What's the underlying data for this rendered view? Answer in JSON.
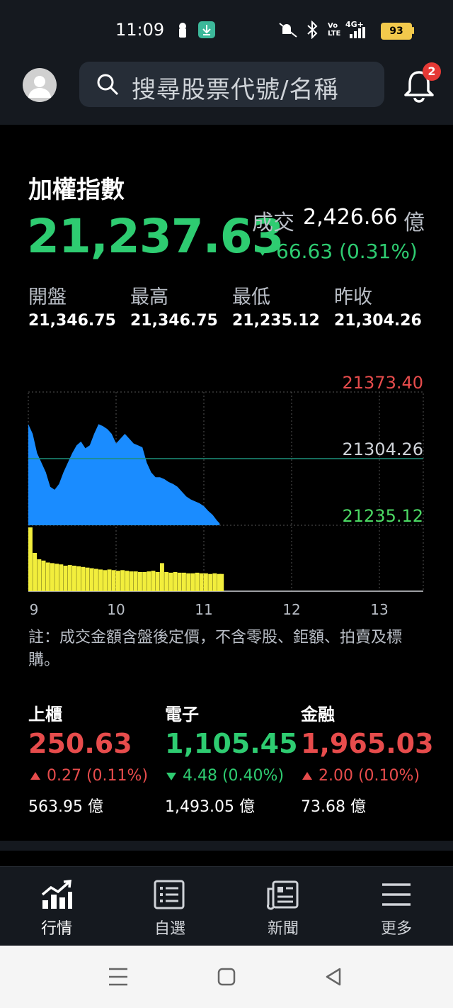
{
  "status_bar": {
    "time": "11:09",
    "battery": "93",
    "icons": [
      "lock-icon",
      "download-icon",
      "mute-icon",
      "bluetooth-icon",
      "volte-icon",
      "signal-4g-icon",
      "battery-icon"
    ],
    "signal_label": "4G+",
    "volte_label": "Vo LTE"
  },
  "header": {
    "search_placeholder": "搜尋股票代號/名稱",
    "notification_count": "2"
  },
  "index": {
    "name": "加權指數",
    "value": "21,237.63",
    "volume_label": "成交",
    "volume_value": "2,426.66",
    "volume_unit": "億",
    "change": "66.63 (0.31%)",
    "direction": "down",
    "stats": [
      {
        "label": "開盤",
        "value": "21,346.75"
      },
      {
        "label": "最高",
        "value": "21,346.75"
      },
      {
        "label": "最低",
        "value": "21,235.12"
      },
      {
        "label": "昨收",
        "value": "21,304.26"
      }
    ]
  },
  "chart_data": {
    "type": "area",
    "price_labels": {
      "high": "21373.40",
      "prev_close": "21304.26",
      "low": "21235.12"
    },
    "ylim": [
      21235.12,
      21373.4
    ],
    "x_ticks": [
      "9",
      "10",
      "11",
      "12",
      "13"
    ],
    "time_x": [
      9.0,
      9.05,
      9.1,
      9.15,
      9.2,
      9.25,
      9.3,
      9.35,
      9.4,
      9.45,
      9.5,
      9.55,
      9.6,
      9.65,
      9.7,
      9.75,
      9.8,
      9.85,
      9.9,
      9.95,
      10.0,
      10.05,
      10.1,
      10.15,
      10.2,
      10.25,
      10.3,
      10.35,
      10.4,
      10.45,
      10.5,
      10.55,
      10.6,
      10.65,
      10.7,
      10.75,
      10.8,
      10.85,
      10.9,
      10.95,
      11.0,
      11.05,
      11.1,
      11.15,
      11.18
    ],
    "price_values": [
      21340,
      21330,
      21310,
      21300,
      21290,
      21275,
      21272,
      21278,
      21290,
      21300,
      21310,
      21318,
      21322,
      21315,
      21318,
      21330,
      21340,
      21338,
      21335,
      21330,
      21320,
      21325,
      21330,
      21325,
      21320,
      21318,
      21316,
      21300,
      21290,
      21285,
      21285,
      21283,
      21280,
      21278,
      21275,
      21270,
      21265,
      21262,
      21260,
      21258,
      21255,
      21250,
      21246,
      21240,
      21237
    ],
    "volume_values": [
      100,
      60,
      50,
      48,
      45,
      44,
      43,
      42,
      40,
      41,
      40,
      39,
      38,
      37,
      36,
      35,
      34,
      33,
      34,
      33,
      32,
      33,
      32,
      31,
      31,
      30,
      30,
      31,
      32,
      30,
      44,
      30,
      29,
      30,
      29,
      29,
      28,
      28,
      29,
      28,
      28,
      27,
      28,
      27,
      27
    ],
    "colors": {
      "price_fill": "#1a8cff",
      "volume_fill": "#f2ee3c",
      "high": "#e74c4c",
      "low": "#4cd964",
      "prev_close_line": "#1e8f7a"
    }
  },
  "note": "註：成交金額含盤後定價，不含零股、鉅額、拍賣及標購。",
  "sub_indices": [
    {
      "name": "上櫃",
      "value": "250.63",
      "change": "0.27 (0.11%)",
      "volume": "563.95 億",
      "direction": "up",
      "color": "#e74c4c"
    },
    {
      "name": "電子",
      "value": "1,105.45",
      "change": "4.48 (0.40%)",
      "volume": "1,493.05 億",
      "direction": "down",
      "color": "#2ecc71"
    },
    {
      "name": "金融",
      "value": "1,965.03",
      "change": "2.00 (0.10%)",
      "volume": "73.68 億",
      "direction": "up",
      "color": "#e74c4c"
    }
  ],
  "bottom_nav": [
    {
      "label": "行情",
      "icon": "market-chart-icon",
      "active": true
    },
    {
      "label": "自選",
      "icon": "watchlist-icon",
      "active": false
    },
    {
      "label": "新聞",
      "icon": "news-icon",
      "active": false
    },
    {
      "label": "更多",
      "icon": "menu-icon",
      "active": false
    }
  ],
  "system_nav": [
    "recent-apps-icon",
    "home-icon",
    "back-icon"
  ]
}
